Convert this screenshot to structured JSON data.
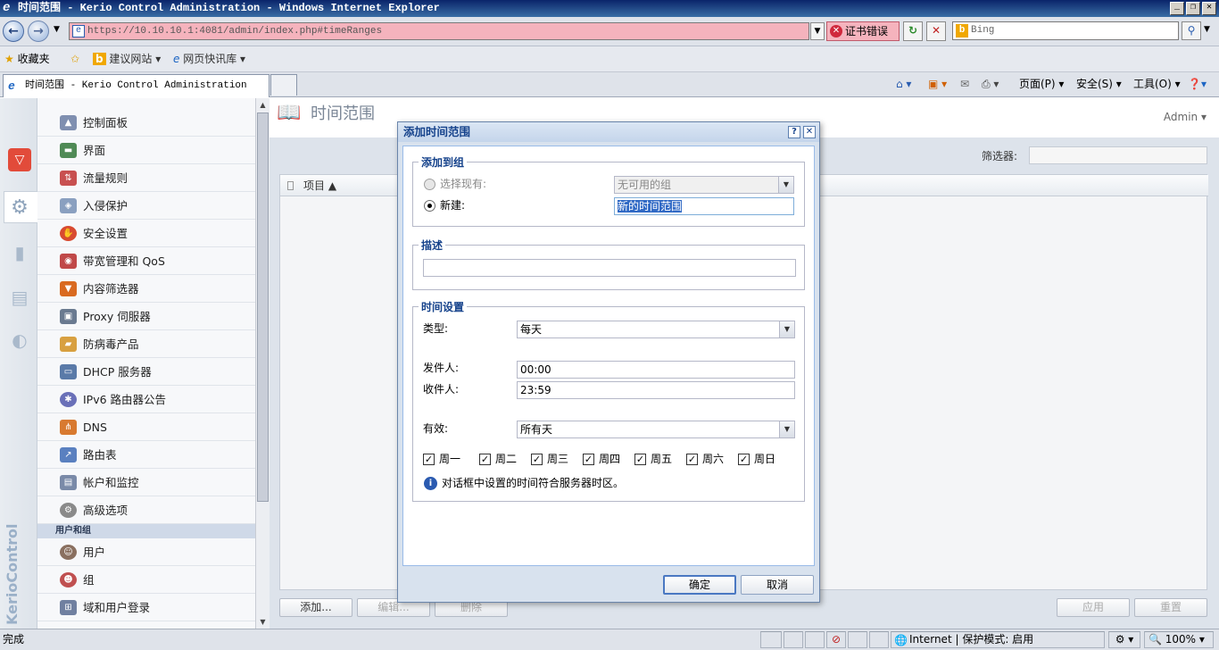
{
  "window": {
    "title": "时间范围 - Kerio Control Administration - Windows Internet Explorer"
  },
  "address": {
    "url": "https://10.10.10.1:4081/admin/index.php#timeRanges",
    "cert_error": "证书错误",
    "search_placeholder": "Bing"
  },
  "favorites": {
    "label": "收藏夹",
    "items": [
      "建议网站 ▾",
      "网页快讯库 ▾"
    ]
  },
  "tab": {
    "title": "时间范围 - Kerio Control Administration"
  },
  "commands": {
    "page": "页面(P) ▾",
    "safety": "安全(S) ▾",
    "tools": "工具(O) ▾"
  },
  "sidebar": {
    "items": [
      "控制面板",
      "界面",
      "流量规则",
      "入侵保护",
      "安全设置",
      "带宽管理和 QoS",
      "内容筛选器",
      "Proxy 伺服器",
      "防病毒产品",
      "DHCP 服务器",
      "IPv6 路由器公告",
      "DNS",
      "路由表",
      "帐户和监控",
      "高级选项"
    ],
    "group_header": "用户和组",
    "group_items": [
      "用户",
      "组",
      "域和用户登录"
    ],
    "brand": "KerioControl"
  },
  "main": {
    "title": "时间范围",
    "user": "Admin ▾",
    "filter_label": "筛选器:",
    "grid_column": "项目 ▲",
    "buttons": {
      "add": "添加...",
      "edit": "编辑...",
      "delete": "删除",
      "apply": "应用",
      "reset": "重置"
    }
  },
  "dialog": {
    "title": "添加时间范围",
    "group_legend": "添加到组",
    "select_existing": "选择现有:",
    "no_group": "无可用的组",
    "new_label": "新建:",
    "new_value": "新的时间范围",
    "desc_legend": "描述",
    "desc_value": "",
    "time_legend": "时间设置",
    "type_label": "类型:",
    "type_value": "每天",
    "from_label": "发件人:",
    "from_value": "00:00",
    "to_label": "收件人:",
    "to_value": "23:59",
    "valid_label": "有效:",
    "valid_value": "所有天",
    "days": [
      "周一",
      "周二",
      "周三",
      "周四",
      "周五",
      "周六",
      "周日"
    ],
    "info": "对话框中设置的时间符合服务器时区。",
    "ok": "确定",
    "cancel": "取消"
  },
  "status": {
    "left": "完成",
    "zone": "Internet | 保护模式: 启用",
    "zoom": "100%"
  }
}
